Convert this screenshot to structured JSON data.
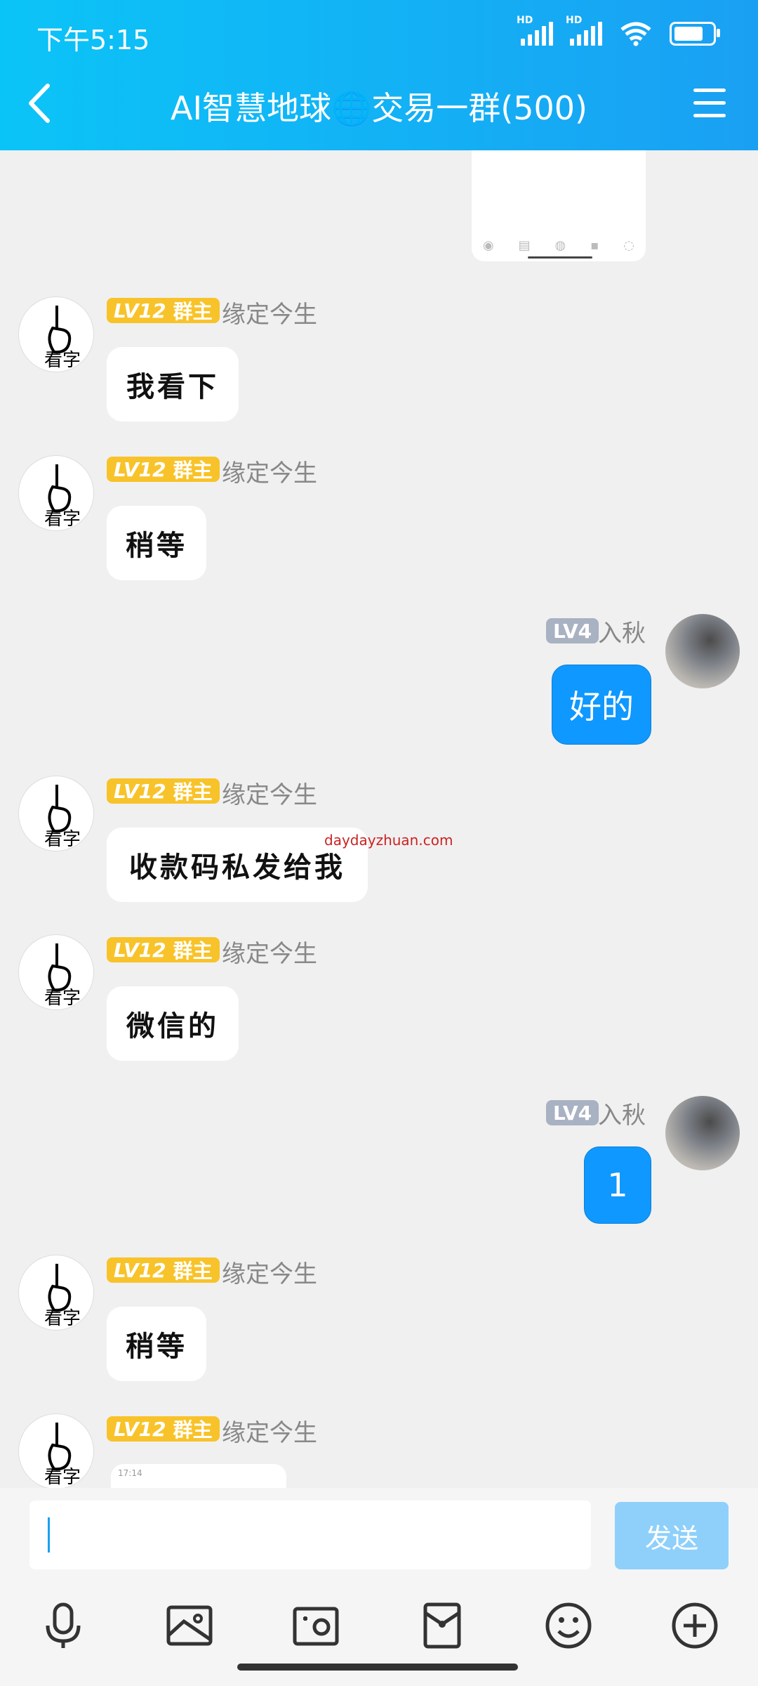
{
  "status_bar": {
    "time": "下午5:15",
    "hd1": "HD",
    "hd2": "HD"
  },
  "header": {
    "title": "AI智慧地球🌐交易一群(500)"
  },
  "messages": [
    {
      "side": "left",
      "badge_lv": "LV12",
      "badge_role": "群主",
      "nick": "缘定今生",
      "text": "我看下"
    },
    {
      "side": "left",
      "badge_lv": "LV12",
      "badge_role": "群主",
      "nick": "缘定今生",
      "text": "稍等"
    },
    {
      "side": "right",
      "badge_lv": "LV4",
      "nick": "入秋",
      "text": "好的"
    },
    {
      "side": "left",
      "badge_lv": "LV12",
      "badge_role": "群主",
      "nick": "缘定今生",
      "text": "收款码私发给我"
    },
    {
      "side": "left",
      "badge_lv": "LV12",
      "badge_role": "群主",
      "nick": "缘定今生",
      "text": "微信的"
    },
    {
      "side": "right",
      "badge_lv": "LV4",
      "nick": "入秋",
      "text": "1"
    },
    {
      "side": "left",
      "badge_lv": "LV12",
      "badge_role": "群主",
      "nick": "缘定今生",
      "text": "稍等"
    },
    {
      "side": "left",
      "badge_lv": "LV12",
      "badge_role": "群主",
      "nick": "缘定今生",
      "text": ""
    }
  ],
  "watermark": "daydayzhuan.com",
  "thumb_text": "17:14",
  "input": {
    "placeholder": "",
    "send_label": "发送"
  },
  "toolbar": [
    "microphone-icon",
    "photo-icon",
    "camera-icon",
    "red-packet-icon",
    "emoji-icon",
    "plus-icon"
  ]
}
